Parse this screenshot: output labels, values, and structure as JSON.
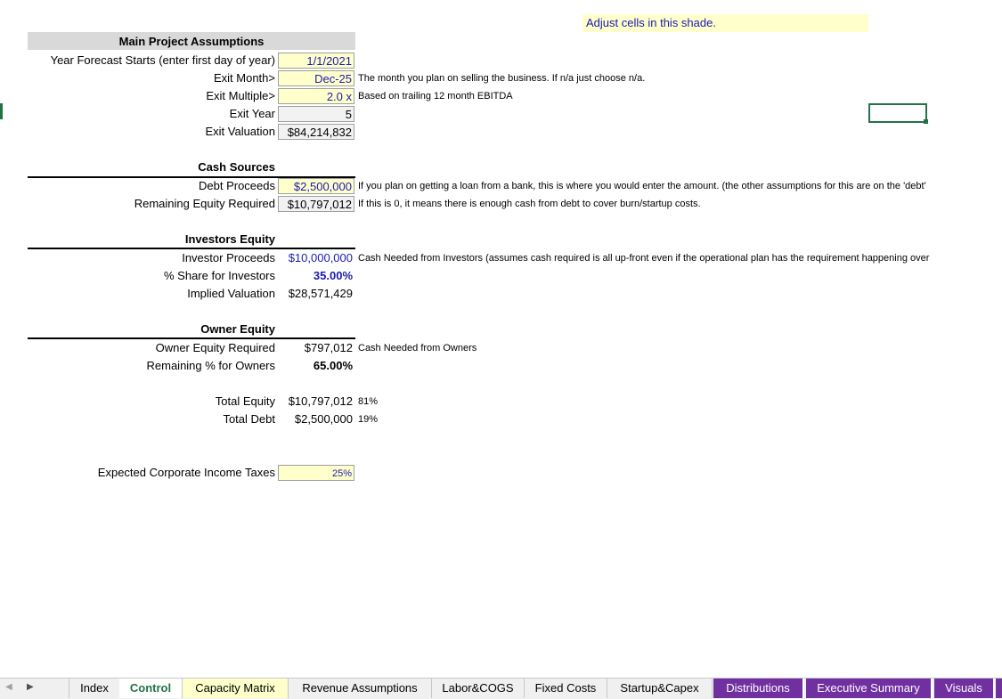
{
  "shade_note": "Adjust cells in this shade.",
  "main": {
    "header": "Main Project Assumptions",
    "rows": [
      {
        "label": "Year Forecast Starts (enter first day of year)",
        "value": "1/1/2021",
        "note": ""
      },
      {
        "label": "Exit Month>",
        "value": "Dec-25",
        "note": "The month you plan on selling the business. If n/a just choose n/a."
      },
      {
        "label": "Exit Multiple>",
        "value": "2.0 x",
        "note": "Based on trailing 12 month EBITDA"
      },
      {
        "label": "Exit Year",
        "value": "5",
        "note": ""
      },
      {
        "label": "Exit Valuation",
        "value": "$84,214,832",
        "note": ""
      }
    ]
  },
  "cash_sources": {
    "header": "Cash Sources",
    "rows": [
      {
        "label": "Debt Proceeds",
        "value": "$2,500,000",
        "note": "If you plan on getting a loan from a bank, this is where you would enter the amount. (the other assumptions for this are on the 'debt'"
      },
      {
        "label": "Remaining Equity Required",
        "value": "$10,797,012",
        "note": "If this is 0, it means there is enough cash from debt to cover burn/startup costs."
      }
    ]
  },
  "investors": {
    "header": "Investors Equity",
    "rows": [
      {
        "label": "Investor Proceeds",
        "value": "$10,000,000",
        "note": "Cash Needed from Investors (assumes cash required is all up-front even if the operational plan has the requirement happening over"
      },
      {
        "label": "% Share for Investors",
        "value": "35.00%",
        "note": ""
      },
      {
        "label": "Implied Valuation",
        "value": "$28,571,429",
        "note": ""
      }
    ]
  },
  "owner": {
    "header": "Owner Equity",
    "rows": [
      {
        "label": "Owner Equity Required",
        "value": "$797,012",
        "note": "Cash Needed from Owners"
      },
      {
        "label": "Remaining % for Owners",
        "value": "65.00%",
        "note": ""
      }
    ]
  },
  "totals": {
    "rows": [
      {
        "label": "Total Equity",
        "value": "$10,797,012",
        "pct": "81%"
      },
      {
        "label": "Total Debt",
        "value": "$2,500,000",
        "pct": "19%"
      }
    ]
  },
  "taxes": {
    "label": "Expected Corporate Income Taxes",
    "value": "25%"
  },
  "tabs": [
    "Index",
    "Control",
    "Capacity Matrix",
    "Revenue Assumptions",
    "Labor&COGS",
    "Fixed Costs",
    "Startup&Capex",
    "Distributions",
    "Executive Summary",
    "Visuals"
  ],
  "colors": {
    "input_shade": "#ffffcc",
    "input_text": "#1a1ab0",
    "tab_purple": "#7030a0",
    "active_tab_text": "#217346"
  }
}
